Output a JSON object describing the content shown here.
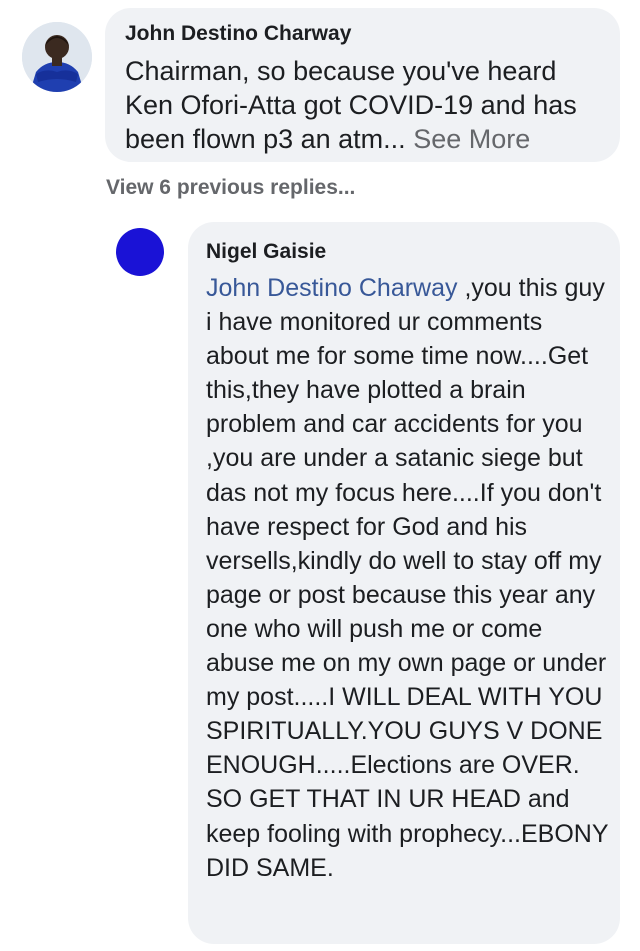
{
  "comment": {
    "author": "John Destino Charway",
    "text": "Chairman, so because you've heard Ken Ofori-Atta got COVID-19 and has been flown p3 an atm...",
    "see_more": "See More",
    "avatar_icon": "profile-photo-man-blue-suit"
  },
  "replies": {
    "view_previous": "View 6 previous replies..."
  },
  "reply": {
    "author": "Nigel Gaisie",
    "mention": "John Destino Charway",
    "text": " ,you this guy i have monitored ur comments about me for some time now....Get this,they have plotted a brain problem and car accidents for you ,you are under a satanic siege but das not my focus here....If you don't have respect for God and his versells,kindly do well to stay off my page or post because this year any one who will push me or come abuse me on my own page or under my post.....I WILL DEAL WITH YOU SPIRITUALLY.YOU GUYS V DONE ENOUGH.....Elections are OVER. SO GET THAT IN UR HEAD and keep fooling with prophecy...EBONY DID SAME.",
    "avatar_color": "#1a12d6",
    "avatar_icon": "default-avatar-blue-circle"
  },
  "colors": {
    "bubble_bg": "#f0f2f5",
    "mention_link": "#385898",
    "secondary_text": "#65676b"
  }
}
